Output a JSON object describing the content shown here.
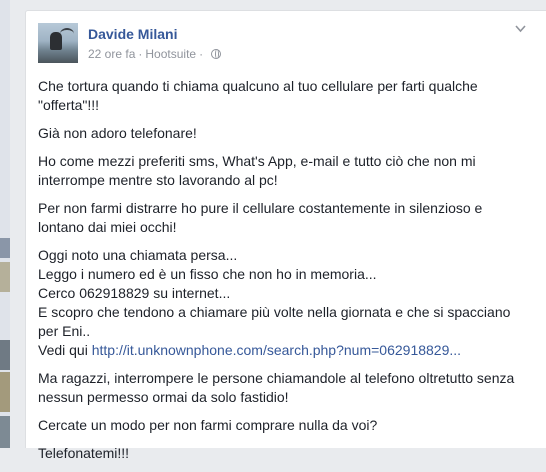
{
  "post": {
    "author": "Davide Milani",
    "time": "22 ore fa",
    "separator": "·",
    "source": "Hootsuite",
    "p1": "Che tortura quando ti chiama qualcuno al tuo cellulare per farti qualche \"offerta\"!!!",
    "p2": "Già non adoro telefonare!",
    "p3": "Ho come mezzi preferiti sms, What's App, e-mail e tutto ciò che non mi interrompe mentre sto lavorando al pc!",
    "p4": "Per non farmi distrarre ho pure il cellulare costantemente in silenzioso e lontano dai miei occhi!",
    "p5_lines": [
      "Oggi noto una chiamata persa...",
      "Leggo i numero ed è un fisso che non ho in memoria...",
      "Cerco 062918829 su internet...",
      "E scopro che tendono a chiamare più volte nella giornata e che si spacciano per Eni..",
      "Vedi qui "
    ],
    "link_text": "http://it.unknownphone.com/search.php?num=062918829...",
    "p6": "Ma ragazzi, interrompere le persone chiamandole al telefono oltretutto senza nessun permesso ormai da solo fastidio!",
    "p7": "Cercate un modo per non farmi comprare nulla da voi?",
    "p8": "Telefonatemi!!!"
  },
  "icons": {
    "audience": "globe-icon",
    "menu": "chevron-down-icon"
  },
  "colors": {
    "link": "#365899",
    "text": "#1d2129",
    "meta": "#90949c",
    "background": "#e9ebee"
  }
}
